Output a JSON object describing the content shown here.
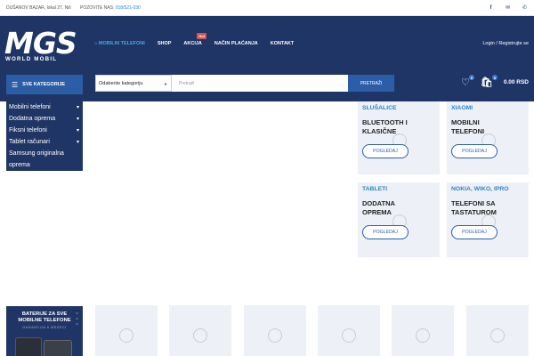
{
  "topbar": {
    "address": "DUŠANOV BAZAR, lokal 27, Niš",
    "phone_label": "POZOVITE NAS:",
    "phone_number": "018/521-030",
    "social_icons": [
      "facebook-icon",
      "email-icon",
      "phone-icon"
    ]
  },
  "logo": {
    "main": "MGS",
    "sub": "WORLD MOBIL"
  },
  "nav": {
    "items": [
      {
        "label": "MOBILNI TELEFONI",
        "active": true
      },
      {
        "label": "SHOP"
      },
      {
        "label": "AKCIJA",
        "badge": "Hot"
      },
      {
        "label": "NAČIN PLAĆANJA"
      },
      {
        "label": "KONTAKT"
      }
    ],
    "login": "Login / Registrujte se"
  },
  "categories_button": "SVE KATEGORIJE",
  "search": {
    "select_value": "Odaberite kategoriju",
    "placeholder": "Pretraži",
    "button": "PRETRAŽI"
  },
  "header_cart": {
    "wishlist_count": "0",
    "cart_count": "0",
    "total": "0.00 RSD"
  },
  "category_list": [
    "Mobilni telefoni",
    "Dodatna oprema",
    "Fiksni telefoni",
    "Tablet računari",
    "Samsung originalna",
    "oprema"
  ],
  "cards": [
    {
      "tag": "SLUŠALICE",
      "title": "BLUETOOTH I KLASIČNE",
      "button": "POGLEDAJ"
    },
    {
      "tag": "XIAOMI",
      "title": "MOBILNI TELEFONI",
      "button": "POGLEDAJ"
    },
    {
      "tag": "TABLETI",
      "title": "DODATNA OPREMA",
      "button": "POGLEDAJ"
    },
    {
      "tag": "NOKIA, WIKO, IPRO",
      "title": "TELEFONI SA TASTATUROM",
      "button": "POGLEDAJ"
    }
  ],
  "promo": {
    "line1": "BATERIJE ZA SVE MOBILNE TELEFONE",
    "line2": "GARANCIJA 6 MESECI"
  },
  "colors": {
    "navy": "#1f3565",
    "accent": "#2c5ea8",
    "link": "#2a86c9",
    "card_bg": "#eef0f7",
    "hot": "#d9534f"
  }
}
